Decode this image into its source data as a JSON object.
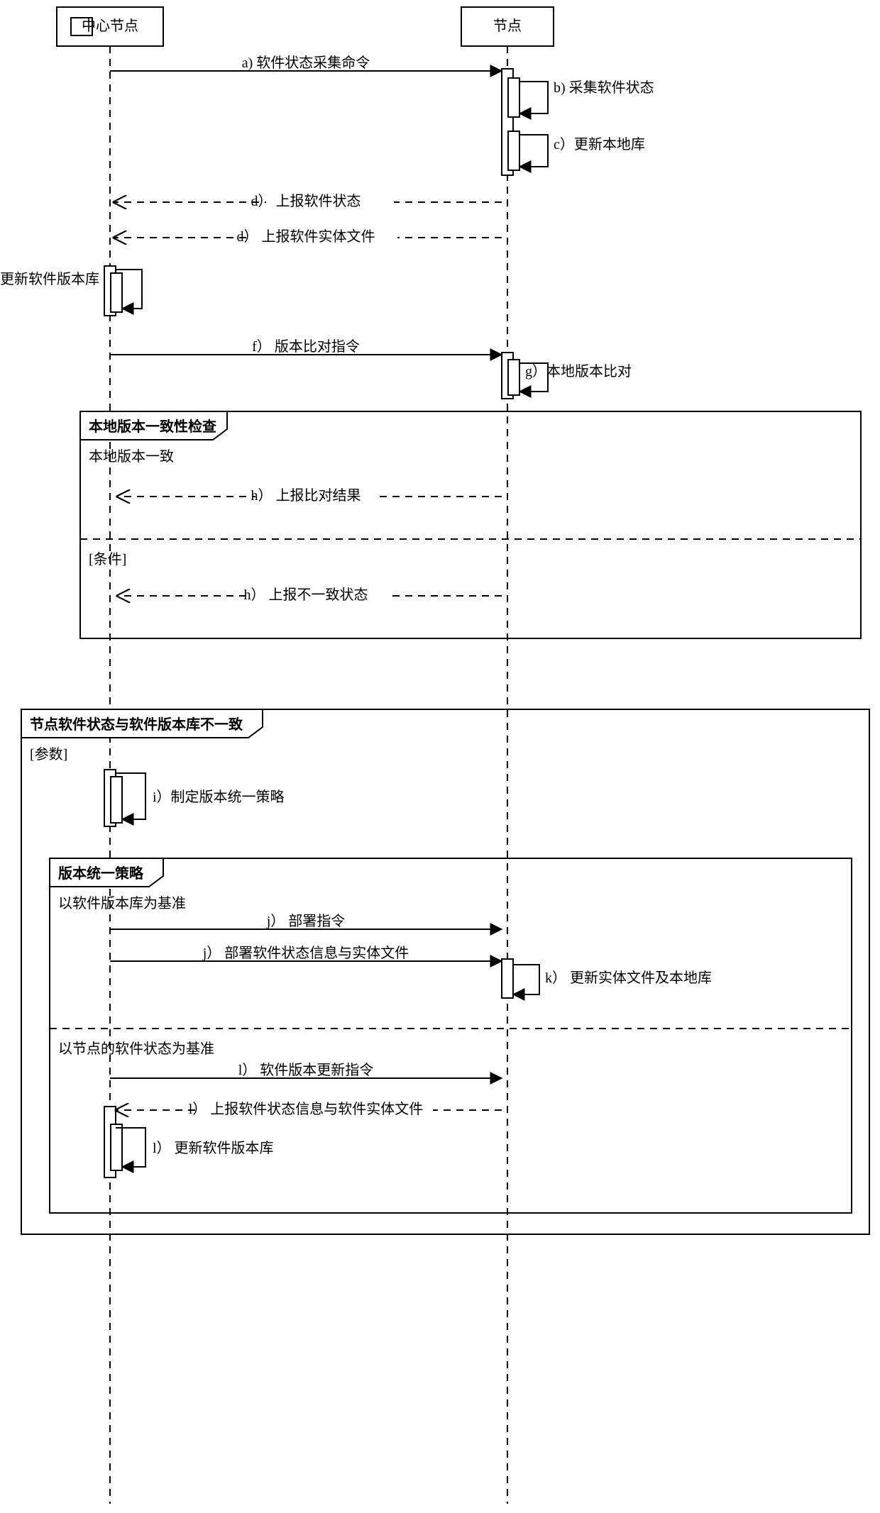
{
  "participants": {
    "center": "中心节点",
    "node": "节点"
  },
  "messages": {
    "a": "a) 软件状态采集命令",
    "b": "b) 采集软件状态",
    "c": "c）更新本地库",
    "d1": "d） 上报软件状态",
    "d2": "d） 上报软件实体文件",
    "e": "e） 构建/更新软件版本库",
    "f": "f） 版本比对指令",
    "g": "g）本地版本比对",
    "h1": "h） 上报比对结果",
    "h2": "h） 上报不一致状态",
    "i": "i）制定版本统一策略",
    "j1": "j） 部署指令",
    "j2": "j） 部署软件状态信息与实体文件",
    "k": "k） 更新实体文件及本地库",
    "l1": "l） 软件版本更新指令",
    "l2": "l） 上报软件状态信息与软件实体文件",
    "l3": "l） 更新软件版本库"
  },
  "fragments": {
    "frag1_title": "本地版本一致性检查",
    "frag1_guard1": "本地版本一致",
    "frag1_guard2": "[条件]",
    "frag2_title": "节点软件状态与软件版本库不一致",
    "frag2_guard": "[参数]",
    "frag3_title": "版本统一策略",
    "frag3_guard1": "以软件版本库为基准",
    "frag3_guard2": "以节点的软件状态为基准"
  }
}
